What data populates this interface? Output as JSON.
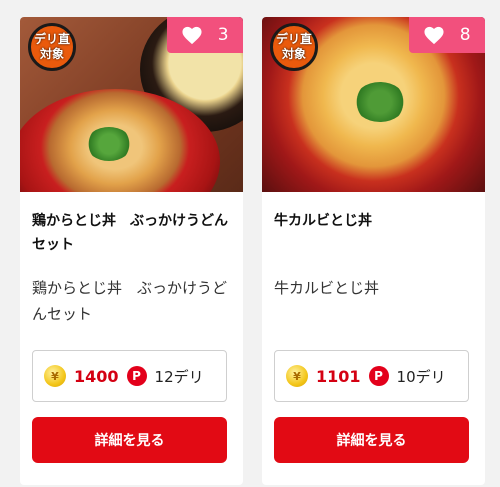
{
  "products": [
    {
      "name": "鶏からとじ丼　ぶっかけうどんセット",
      "description": "鶏からとじ丼　ぶっかけうどんセット",
      "badge_line1": "デリ直",
      "badge_line2": "対象",
      "likes": "3",
      "currency_icon": "¥",
      "price": "1400",
      "point_icon": "P",
      "points": "12デリ",
      "button_label": "詳細を見る"
    },
    {
      "name": "牛カルビとじ丼",
      "description": "牛カルビとじ丼",
      "badge_line1": "デリ直",
      "badge_line2": "対象",
      "likes": "8",
      "currency_icon": "¥",
      "price": "1101",
      "point_icon": "P",
      "points": "10デリ",
      "button_label": "詳細を見る"
    }
  ],
  "colors": {
    "accent_red": "#e20a14",
    "price_red": "#d40012",
    "like_pink": "#f2507d",
    "badge_orange": "#ea5a0c",
    "coin_gold": "#f3c61a"
  },
  "icons": {
    "like": "heart-icon",
    "currency": "yen-coin-icon",
    "point": "point-p-icon"
  }
}
